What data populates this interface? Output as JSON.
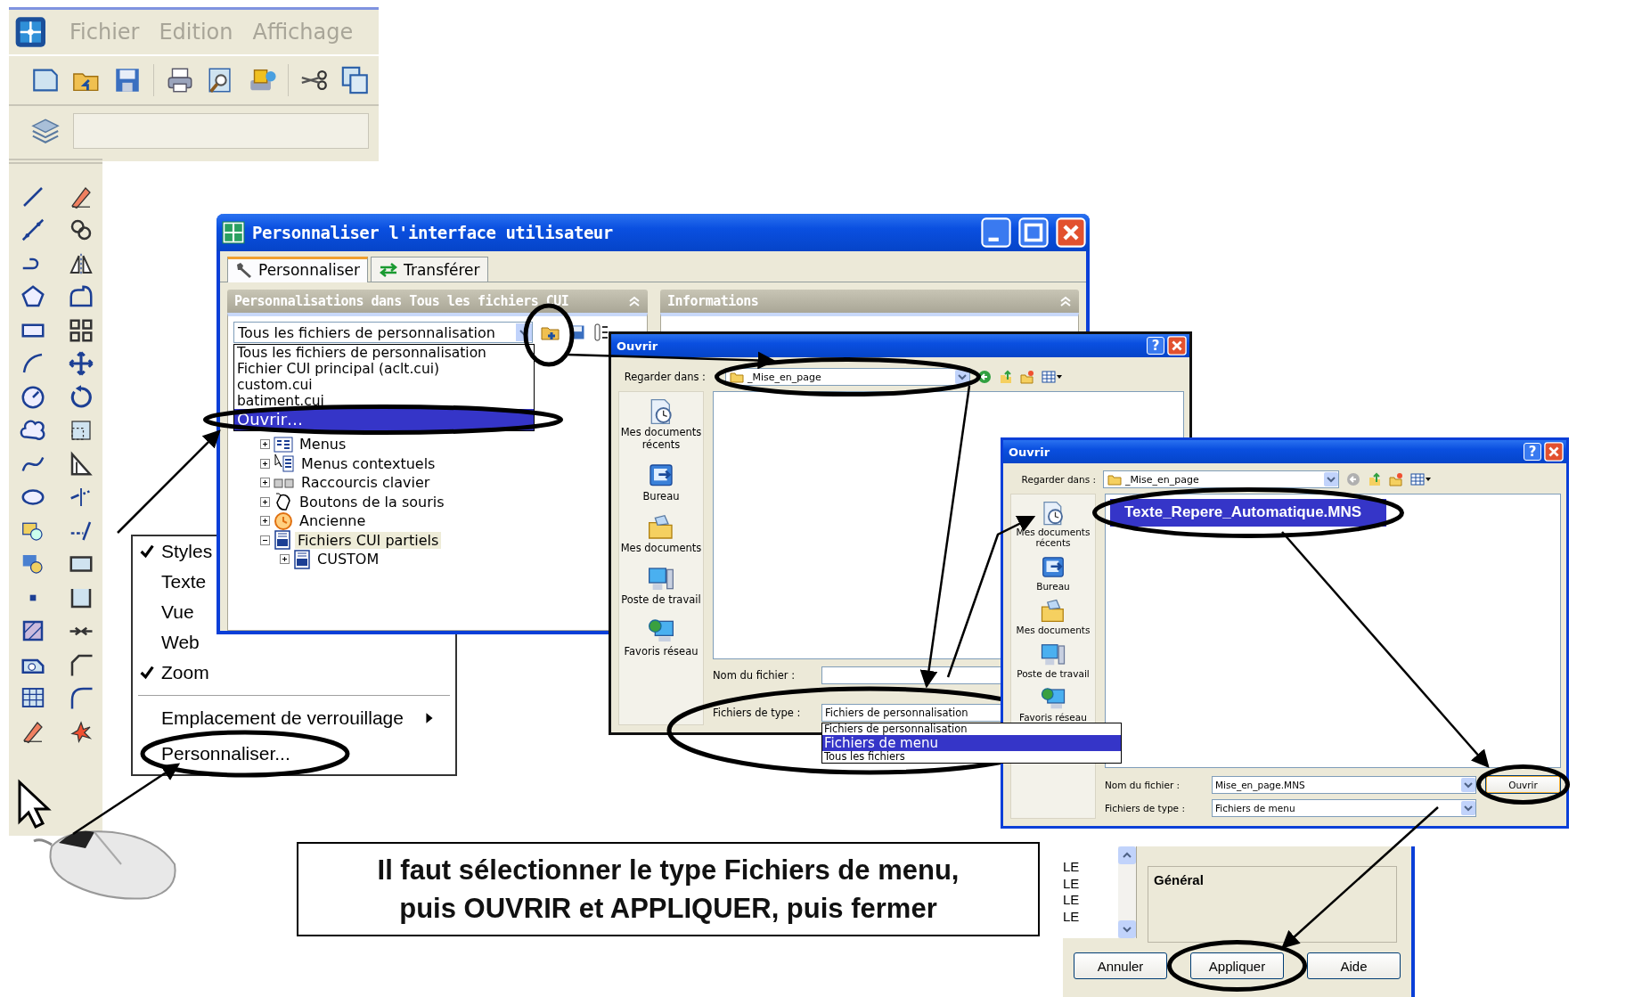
{
  "app": {
    "menu": [
      {
        "label": "Fichier"
      },
      {
        "label": "Edition"
      },
      {
        "label": "Affichage"
      }
    ]
  },
  "context_menu": {
    "items": [
      {
        "kind": "check",
        "label": "Styles",
        "checked": true
      },
      {
        "kind": "check",
        "label": "Texte",
        "checked": false
      },
      {
        "kind": "check",
        "label": "Vue",
        "checked": false
      },
      {
        "kind": "check",
        "label": "Web",
        "checked": false
      },
      {
        "kind": "check",
        "label": "Zoom",
        "checked": true
      },
      {
        "kind": "separator"
      },
      {
        "kind": "submenu",
        "label": "Emplacement de verrouillage"
      },
      {
        "kind": "check",
        "label": "Personnaliser...",
        "checked": false
      }
    ]
  },
  "cui_dialog": {
    "title": "Personnaliser l'interface utilisateur",
    "tabs": [
      {
        "label": "Personnaliser",
        "selected": true
      },
      {
        "label": "Transférer",
        "selected": false
      }
    ],
    "left_panel_title": "Personnalisations dans Tous les fichiers CUI",
    "right_panel_title": "Informations",
    "file_select": "Tous les fichiers de personnalisation",
    "file_options": [
      {
        "label": "Tous les fichiers de personnalisation",
        "selected": false
      },
      {
        "label": "Fichier CUI principal (aclt.cui)",
        "selected": false
      },
      {
        "label": "custom.cui",
        "selected": false
      },
      {
        "label": "batiment.cui",
        "selected": false
      },
      {
        "label": "Ouvrir…",
        "selected": true
      }
    ],
    "tree": [
      {
        "label": "Menus",
        "kind": "menus",
        "expanded": false,
        "selected": false
      },
      {
        "label": "Menus contextuels",
        "kind": "context",
        "expanded": false,
        "selected": false
      },
      {
        "label": "Raccourcis clavier",
        "kind": "keys",
        "expanded": false,
        "selected": false
      },
      {
        "label": "Boutons de la souris",
        "kind": "mouse",
        "expanded": false,
        "selected": false
      },
      {
        "label": "Ancienne",
        "kind": "legacy",
        "expanded": false,
        "selected": false
      },
      {
        "label": "Fichiers CUI partiels",
        "kind": "cui",
        "expanded": true,
        "selected": true,
        "children": [
          {
            "label": "CUSTOM",
            "kind": "cui",
            "expanded": false,
            "selected": false
          }
        ]
      }
    ]
  },
  "open_dialog_1": {
    "title": "Ouvrir",
    "help_button": "?",
    "look_in_label": "Regarder dans :",
    "look_in_value": "_Mise_en_page",
    "places": [
      {
        "kind": "recent",
        "label": "Mes documents récents"
      },
      {
        "kind": "desktop",
        "label": "Bureau"
      },
      {
        "kind": "documents",
        "label": "Mes documents"
      },
      {
        "kind": "computer",
        "label": "Poste de travail"
      },
      {
        "kind": "network",
        "label": "Favoris réseau"
      }
    ],
    "file_name_label": "Nom du fichier :",
    "file_type_label": "Fichiers de type :",
    "file_type_value": "Fichiers de personnalisation",
    "file_type_options": [
      {
        "label": "Fichiers de personnalisation",
        "selected": false
      },
      {
        "label": "Fichiers de menu",
        "selected": true
      },
      {
        "label": "Tous les fichiers",
        "selected": false
      }
    ]
  },
  "open_dialog_2": {
    "title": "Ouvrir",
    "help_button": "?",
    "look_in_label": "Regarder dans :",
    "look_in_value": "_Mise_en_page",
    "places": [
      {
        "kind": "recent",
        "label": "Mes documents récents"
      },
      {
        "kind": "desktop",
        "label": "Bureau"
      },
      {
        "kind": "documents",
        "label": "Mes documents"
      },
      {
        "kind": "computer",
        "label": "Poste de travail"
      },
      {
        "kind": "network",
        "label": "Favoris réseau"
      }
    ],
    "files": [
      {
        "name": "Texte_Repere_Automatique.MNS",
        "selected": true
      }
    ],
    "file_name_label": "Nom du fichier :",
    "file_name_value": "Mise_en_page.MNS",
    "file_type_label": "Fichiers de type :",
    "file_type_value": "Fichiers de menu",
    "open_button": "Ouvrir"
  },
  "properties_panel": {
    "list_items": [
      "LE",
      "LE",
      "LE",
      "LE"
    ],
    "section_title": "Général",
    "buttons": [
      "Annuler",
      "Appliquer",
      "Aide"
    ]
  },
  "caption": "Il faut sélectionner le type Fichiers de menu,\npuis OUVRIR et APPLIQUER, puis fermer"
}
